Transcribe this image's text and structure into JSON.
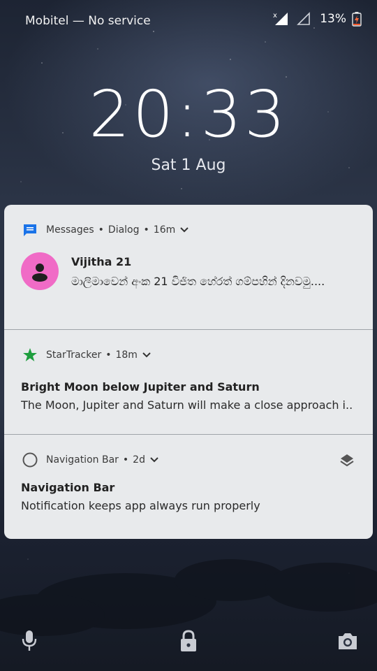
{
  "status_bar": {
    "carrier": "Mobitel — No service",
    "battery_percent": "13%",
    "battery_level": 0.13,
    "icons": [
      "signal-off-icon",
      "signal-empty-icon",
      "battery-charging-icon"
    ]
  },
  "lockscreen": {
    "time": "20:33",
    "date": "Sat 1 Aug"
  },
  "notifications": [
    {
      "app": "Messages",
      "channel": "Dialog",
      "age": "16m",
      "sender": "Vijitha 21",
      "text": "මාලිමාවෙන් අංක 21 විජිත හේරත් ගම්පහින් දිනවමු....",
      "icon": "messages-icon",
      "accent": "#1a73e8"
    },
    {
      "app": "StarTracker",
      "age": "18m",
      "title": "Bright Moon below Jupiter and Saturn",
      "text": "The Moon, Jupiter and Saturn will make a close approach i..",
      "icon": "star-icon",
      "accent": "#1e9e3e"
    },
    {
      "app": "Navigation Bar",
      "age": "2d",
      "title": "Navigation Bar",
      "text": "Notification keeps app always run properly",
      "icon": "circle-icon",
      "action_icon": "layers-icon"
    }
  ],
  "bottom_bar": {
    "icons": [
      "microphone-icon",
      "lock-icon",
      "camera-icon"
    ]
  }
}
